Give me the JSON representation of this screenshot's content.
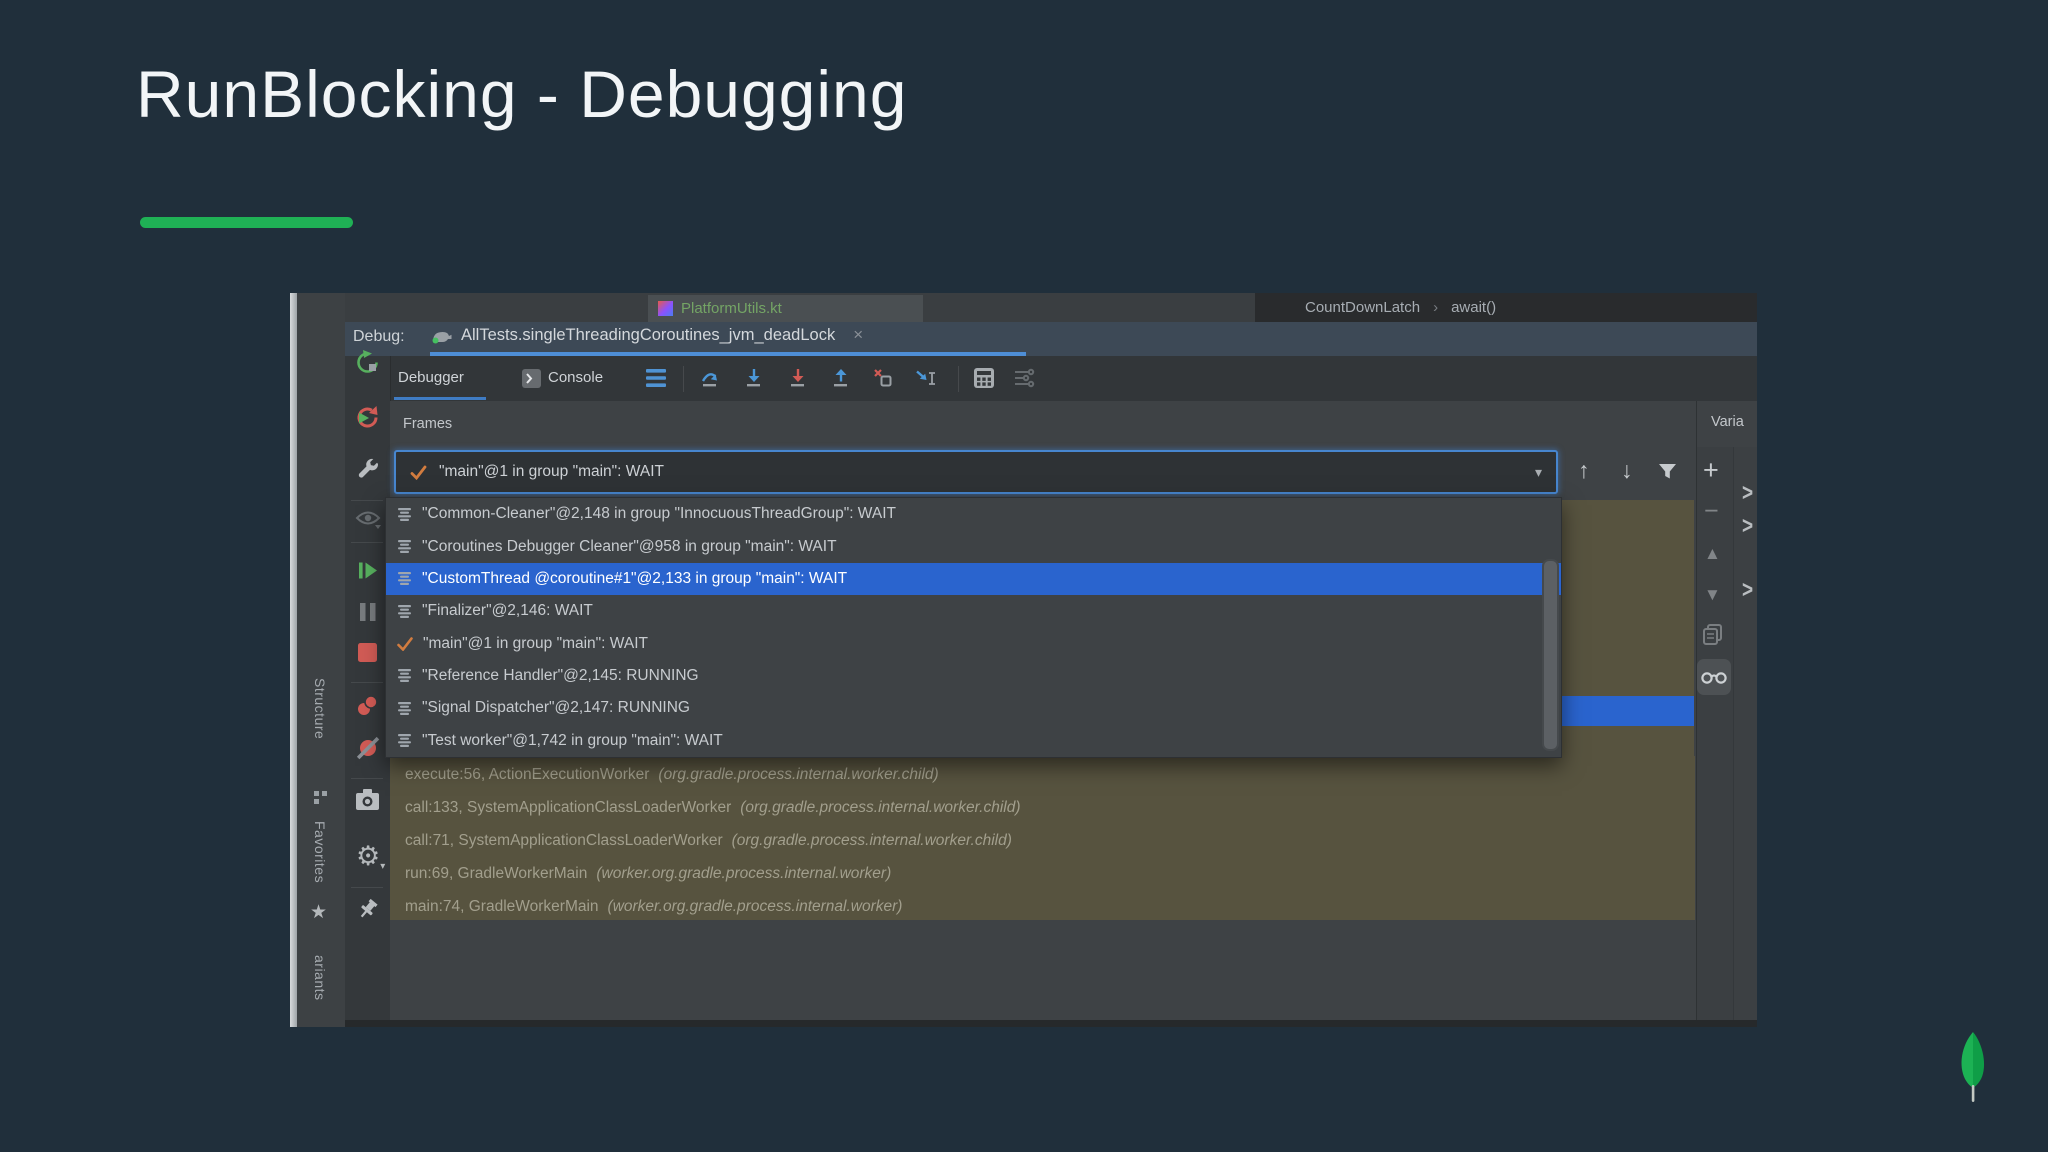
{
  "slide": {
    "title": "RunBlocking - Debugging",
    "accent_color": "#1fb155",
    "logo": "mongodb-leaf-icon"
  },
  "ide": {
    "editor_tab": {
      "icon": "kotlin-file-icon",
      "file_name": "PlatformUtils.kt"
    },
    "breadcrumb": {
      "items": [
        "CountDownLatch",
        "await()"
      ],
      "separator": "›"
    },
    "debug_bar": {
      "label": "Debug:",
      "session_tab": {
        "icon": "gradle-icon",
        "title": "AllTests.singleThreadingCoroutines_jvm_deadLock",
        "close_label": "×"
      }
    },
    "toolbar": {
      "debugger_tab": "Debugger",
      "console_tab": "Console",
      "icons": [
        "console-icon",
        "show-threads-icon",
        "step-over-icon",
        "step-into-icon",
        "force-step-into-icon",
        "step-out-icon",
        "drop-frame-icon",
        "run-to-cursor-icon",
        "evaluate-expression-icon",
        "layout-settings-icon"
      ]
    },
    "left_toolbar": {
      "icons": [
        "rerun-icon",
        "rerun-failed-tests-icon",
        "settings-wrench-icon",
        "show-execution-point-eye-icon",
        "resume-program-icon",
        "pause-program-icon",
        "stop-icon",
        "view-breakpoints-icon",
        "mute-breakpoints-icon",
        "thread-dump-camera-icon",
        "debugger-settings-gear-icon",
        "pin-tab-icon"
      ]
    },
    "tool_strip": {
      "structure_label": "Structure",
      "favorites_label": "Favorites",
      "variants_label": "ariants",
      "icons": [
        "structure-grid-icon",
        "favorites-star-icon"
      ]
    },
    "frames_panel": {
      "title": "Frames",
      "thread_selector": {
        "icon": "current-thread-check-icon",
        "value": "\"main\"@1 in group \"main\": WAIT",
        "arrow": "▾"
      },
      "toolbar_icons": [
        "move-frame-up-icon",
        "move-frame-down-icon",
        "filter-frames-icon"
      ]
    },
    "thread_dropdown": {
      "items": [
        {
          "icon": "thread-icon",
          "text": "\"Common-Cleaner\"@2,148 in group \"InnocuousThreadGroup\": WAIT",
          "selected": false,
          "current": false
        },
        {
          "icon": "thread-icon",
          "text": "\"Coroutines Debugger Cleaner\"@958 in group \"main\": WAIT",
          "selected": false,
          "current": false
        },
        {
          "icon": "thread-icon",
          "text": "\"CustomThread @coroutine#1\"@2,133 in group \"main\": WAIT",
          "selected": true,
          "current": false
        },
        {
          "icon": "thread-icon",
          "text": "\"Finalizer\"@2,146: WAIT",
          "selected": false,
          "current": false
        },
        {
          "icon": "current-thread-check-icon",
          "text": "\"main\"@1 in group \"main\": WAIT",
          "selected": false,
          "current": true
        },
        {
          "icon": "thread-icon",
          "text": "\"Reference Handler\"@2,145: RUNNING",
          "selected": false,
          "current": false
        },
        {
          "icon": "thread-icon",
          "text": "\"Signal Dispatcher\"@2,147: RUNNING",
          "selected": false,
          "current": false
        },
        {
          "icon": "thread-icon",
          "text": "\"Test worker\"@1,742 in group \"main\": WAIT",
          "selected": false,
          "current": false
        }
      ]
    },
    "stack_frames": [
      {
        "location": "execute:56, ActionExecutionWorker",
        "package": "(org.gradle.process.internal.worker.child)"
      },
      {
        "location": "call:133, SystemApplicationClassLoaderWorker",
        "package": "(org.gradle.process.internal.worker.child)"
      },
      {
        "location": "call:71, SystemApplicationClassLoaderWorker",
        "package": "(org.gradle.process.internal.worker.child)"
      },
      {
        "location": "run:69, GradleWorkerMain",
        "package": "(worker.org.gradle.process.internal.worker)"
      },
      {
        "location": "main:74, GradleWorkerMain",
        "package": "(worker.org.gradle.process.internal.worker)"
      }
    ],
    "variables_panel": {
      "title": "Varia",
      "toolbar_icons": [
        "add-watch-icon",
        "remove-watch-icon",
        "move-up-icon",
        "move-down-icon",
        "duplicate-watch-icon",
        "show-watches-icon"
      ],
      "tree_chevron": "›"
    }
  }
}
